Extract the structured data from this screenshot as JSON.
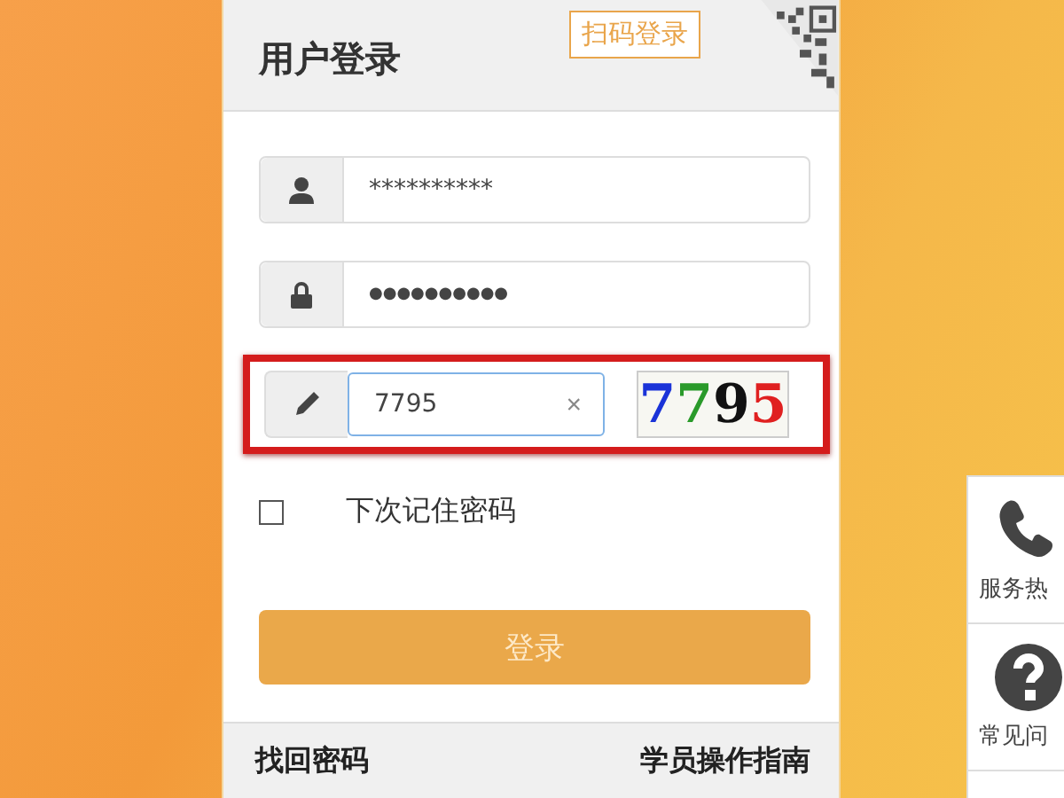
{
  "login_panel": {
    "title": "用户登录",
    "qr_login_label": "扫码登录",
    "fields": [
      {
        "kind": "username",
        "value": "**********",
        "highlighted": false
      },
      {
        "kind": "password",
        "value": "●●●●●●●●●●",
        "highlighted": false
      },
      {
        "kind": "captcha",
        "value": "7795",
        "clear": "×",
        "captcha_image": "7795",
        "highlighted": true
      }
    ],
    "remember": {
      "label": "下次记住密码",
      "checked": false
    },
    "login_button": "登录",
    "footer_links": [
      "找回密码",
      "学员操作指南"
    ]
  },
  "side_panel": {
    "items": [
      {
        "kind": "phone",
        "label": "服务热"
      },
      {
        "kind": "help",
        "label": "常见问"
      },
      {
        "kind": "more"
      }
    ]
  }
}
